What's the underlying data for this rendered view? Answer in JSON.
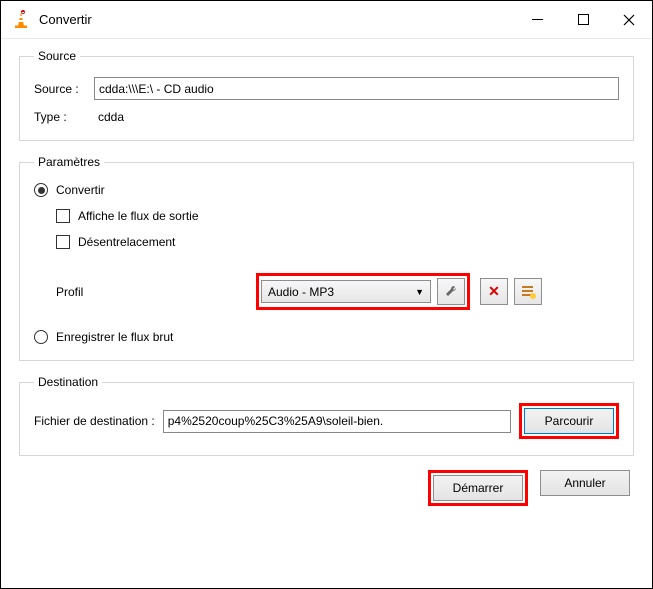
{
  "window": {
    "title": "Convertir"
  },
  "source_group": {
    "legend": "Source",
    "source_label": "Source :",
    "source_value": "cdda:\\\\\\E:\\ - CD audio",
    "type_label": "Type :",
    "type_value": "cdda"
  },
  "params_group": {
    "legend": "Paramètres",
    "convert_radio": "Convertir",
    "show_output_check": "Affiche le flux de sortie",
    "deinterlace_check": "Désentrelacement",
    "profile_label": "Profil",
    "profile_value": "Audio - MP3",
    "raw_radio": "Enregistrer le flux brut"
  },
  "dest_group": {
    "legend": "Destination",
    "dest_label": "Fichier de destination :",
    "dest_value": "p4%2520coup%25C3%25A9\\soleil-bien.",
    "browse_btn": "Parcourir"
  },
  "footer": {
    "start_btn": "Démarrer",
    "cancel_btn": "Annuler"
  }
}
